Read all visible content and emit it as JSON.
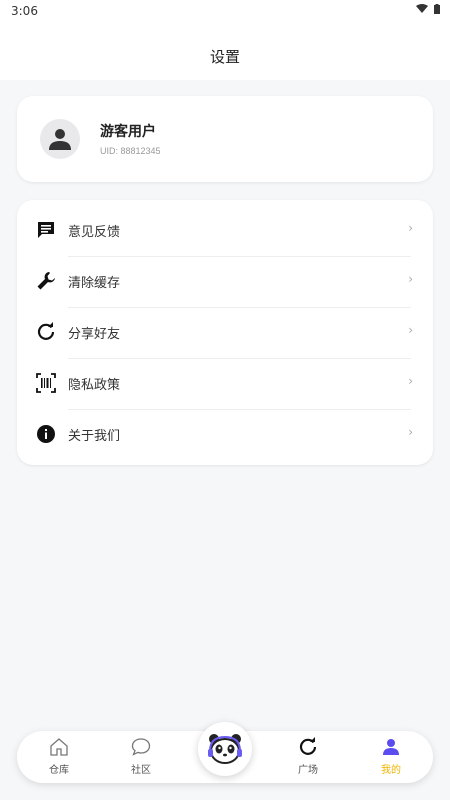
{
  "status_bar": {
    "time": "3:06"
  },
  "header": {
    "title": "设置"
  },
  "profile": {
    "name": "游客用户",
    "uid": "UID: 88812345"
  },
  "menu": {
    "items": [
      {
        "label": "意见反馈",
        "icon": "feedback-icon"
      },
      {
        "label": "清除缓存",
        "icon": "wrench-icon"
      },
      {
        "label": "分享好友",
        "icon": "refresh-icon"
      },
      {
        "label": "隐私政策",
        "icon": "barcode-icon"
      },
      {
        "label": "关于我们",
        "icon": "info-icon"
      }
    ],
    "chevron": "›"
  },
  "bottom_nav": {
    "items": [
      {
        "label": "仓库",
        "icon": "home-icon"
      },
      {
        "label": "社区",
        "icon": "chat-bubble-icon"
      },
      {
        "label": "广场",
        "icon": "refresh-icon"
      },
      {
        "label": "我的",
        "icon": "person-icon"
      }
    ],
    "active_index": 3,
    "center_icon": "panda-logo-icon"
  },
  "colors": {
    "active_label": "#f0b400",
    "active_icon": "#5b4cf0",
    "background": "#f6f7f9"
  }
}
